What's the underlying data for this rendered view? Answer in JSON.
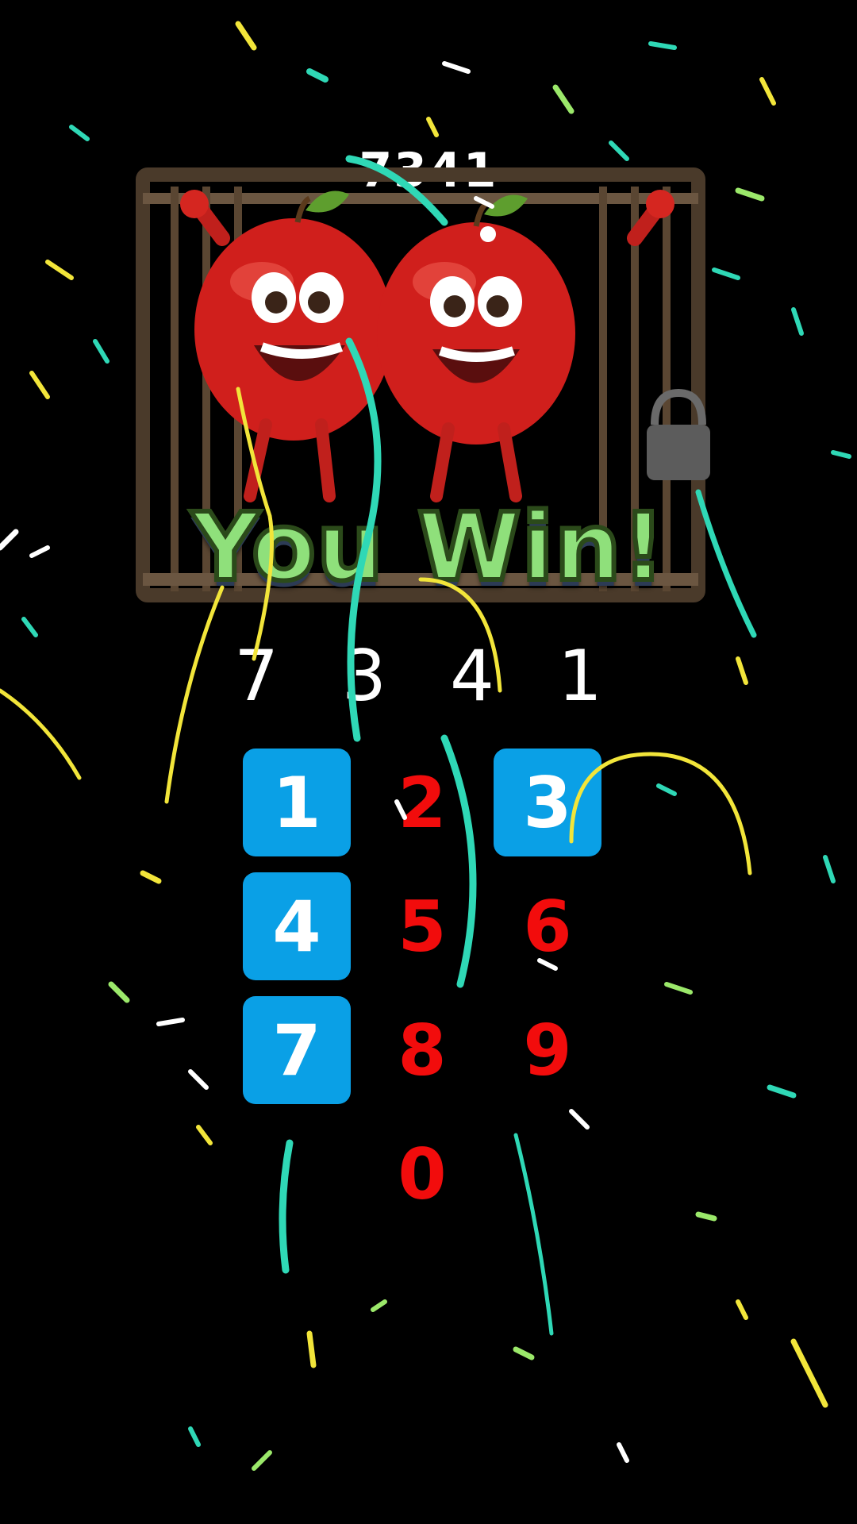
{
  "hint_code": "7341",
  "result": {
    "title": "You Win!"
  },
  "entered_code": "7 3 4 1",
  "keypad": {
    "keys": [
      {
        "label": "1",
        "pressed": true
      },
      {
        "label": "2",
        "pressed": false
      },
      {
        "label": "3",
        "pressed": true
      },
      {
        "label": "4",
        "pressed": true
      },
      {
        "label": "5",
        "pressed": false
      },
      {
        "label": "6",
        "pressed": false
      },
      {
        "label": "7",
        "pressed": true
      },
      {
        "label": "8",
        "pressed": false
      },
      {
        "label": "9",
        "pressed": false
      },
      {
        "label": "0",
        "pressed": false
      }
    ]
  },
  "colors": {
    "background": "#000000",
    "pressed_key": "#0aa0e6",
    "digit": "#f20c0c",
    "title": "#8fe07b",
    "confetti": [
      "#2fd8b6",
      "#f2e53a",
      "#ffffff",
      "#9be86a"
    ]
  }
}
